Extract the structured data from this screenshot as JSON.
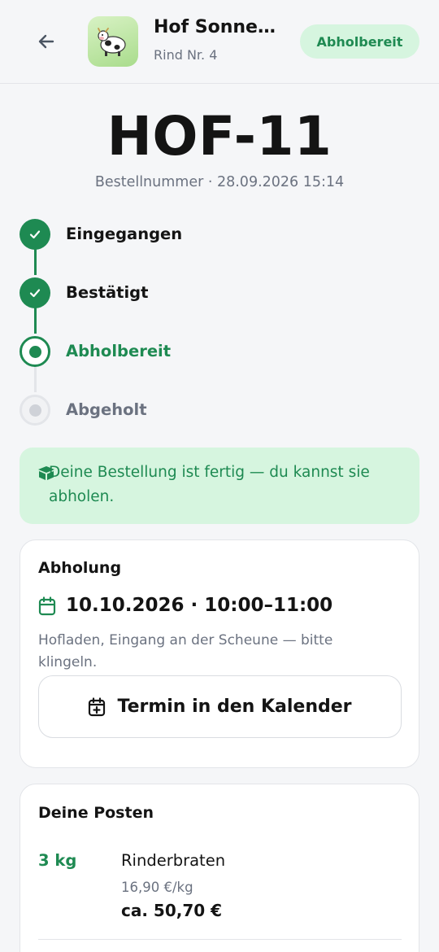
{
  "header": {
    "farm_name": "Hof Sonne…",
    "farm_sub": "Rind Nr. 4",
    "status_badge": "Abholbereit",
    "avatar_emoji": "🐄"
  },
  "order": {
    "id": "HOF-11",
    "meta": "Bestellnummer · 28.09.2026 15:14"
  },
  "timeline": {
    "steps": [
      {
        "label": "Eingegangen",
        "state": "done"
      },
      {
        "label": "Bestätigt",
        "state": "done"
      },
      {
        "label": "Abholbereit",
        "state": "current"
      },
      {
        "label": "Abgeholt",
        "state": "pending"
      }
    ]
  },
  "notice": {
    "text": "Deine Bestellung ist fertig — du kannst sie abholen.",
    "icon": "box-icon"
  },
  "pickup": {
    "title": "Abholung",
    "date_time": "10.10.2026 · 10:00–11:00",
    "note": "Hofladen, Eingang an der Scheune — bitte klingeln.",
    "calendar_button": "Termin in den Kalender"
  },
  "items": {
    "title": "Deine Posten",
    "list": [
      {
        "qty": "3 kg",
        "name": "Rinderbraten",
        "unit_price": "16,90 €/kg",
        "total": "ca. 50,70 €"
      }
    ]
  },
  "colors": {
    "accent": "#1e8a52",
    "accent_soft": "#d6f5df",
    "muted": "#6b7280",
    "background": "#f5f6f8"
  }
}
